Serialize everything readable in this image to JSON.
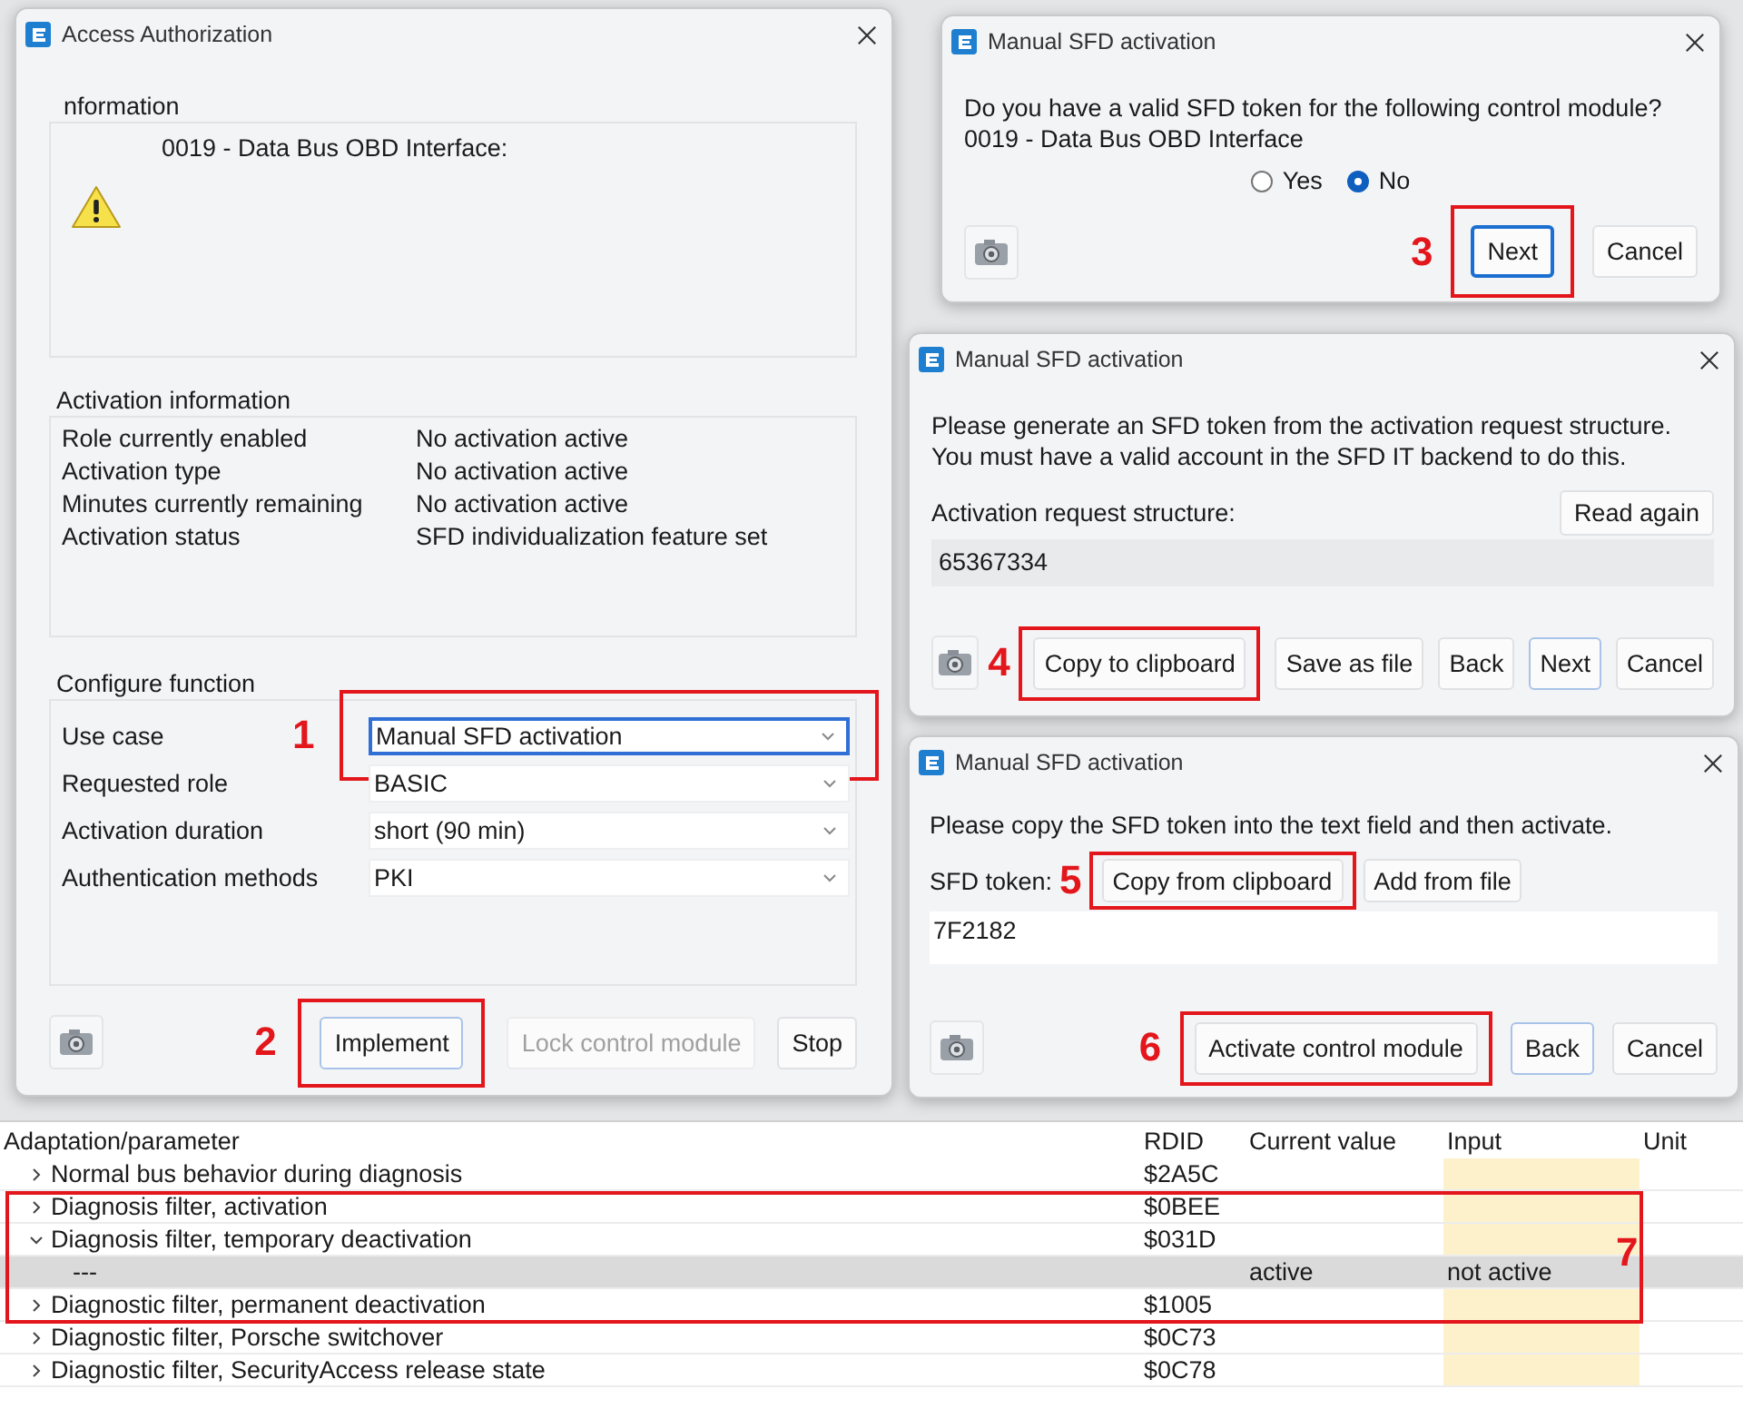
{
  "access_dialog": {
    "title": "Access Authorization",
    "info_group": {
      "legend": "nformation",
      "module": "0019 - Data Bus OBD Interface:"
    },
    "activation_info": {
      "legend": "Activation information",
      "rows": [
        {
          "label": "Role currently enabled",
          "value": "No activation active"
        },
        {
          "label": "Activation type",
          "value": "No activation active"
        },
        {
          "label": "Minutes currently remaining",
          "value": "No activation active"
        },
        {
          "label": "Activation status",
          "value": "SFD individualization feature set"
        }
      ]
    },
    "configure": {
      "legend": "Configure function",
      "rows": [
        {
          "label": "Use case",
          "value": "Manual SFD activation",
          "focused": true,
          "annotation": "1"
        },
        {
          "label": "Requested role",
          "value": "BASIC",
          "focused": false
        },
        {
          "label": "Activation duration",
          "value": "short (90 min)",
          "focused": false
        },
        {
          "label": "Authentication methods",
          "value": "PKI",
          "focused": false
        }
      ]
    },
    "buttons": [
      {
        "label": "Implement",
        "default": true,
        "disabled": false,
        "annotation": "2"
      },
      {
        "label": "Lock control module",
        "default": false,
        "disabled": true
      },
      {
        "label": "Stop",
        "default": false,
        "disabled": false
      }
    ]
  },
  "question_dialog": {
    "title": "Manual SFD activation",
    "lines": [
      "Do you have a valid SFD token for the following control module?",
      "0019 - Data Bus OBD Interface"
    ],
    "options": [
      {
        "label": "Yes",
        "selected": false
      },
      {
        "label": "No",
        "selected": true
      }
    ],
    "buttons": [
      {
        "label": "Next",
        "focused": true,
        "annotation": "3"
      },
      {
        "label": "Cancel",
        "focused": false
      }
    ]
  },
  "request_dialog": {
    "title": "Manual SFD activation",
    "lines": [
      "Please generate an SFD token from the activation request structure.",
      "You must have a valid account in the SFD IT backend to do this."
    ],
    "field_label": "Activation request structure:",
    "read_again": "Read again",
    "request_value": "65367334",
    "buttons": [
      {
        "label": "Copy to clipboard",
        "default": false,
        "annotation": "4"
      },
      {
        "label": "Save as file",
        "default": false
      },
      {
        "label": "Back",
        "default": false
      },
      {
        "label": "Next",
        "default": true
      },
      {
        "label": "Cancel",
        "default": false
      }
    ]
  },
  "token_dialog": {
    "title": "Manual SFD activation",
    "message": "Please copy the SFD token into the text field and then activate.",
    "token_label": "SFD token:",
    "token_buttons": [
      {
        "label": "Copy from clipboard",
        "annotation": "5"
      },
      {
        "label": "Add from file"
      }
    ],
    "token_value": "7F2182",
    "buttons": [
      {
        "label": "Activate control module",
        "default": false,
        "annotation": "6"
      },
      {
        "label": "Back",
        "default": true
      },
      {
        "label": "Cancel",
        "default": false
      }
    ]
  },
  "table": {
    "columns": [
      "Adaptation/parameter",
      "RDID",
      "Current value",
      "Input",
      "Unit"
    ],
    "rows": [
      {
        "parameter": "Normal bus behavior during diagnosis",
        "rdid": "$2A5C",
        "expanded": false,
        "selected": false
      },
      {
        "parameter": "Diagnosis filter, activation",
        "rdid": "$0BEE",
        "expanded": false,
        "selected": false
      },
      {
        "parameter": "Diagnosis filter, temporary deactivation",
        "rdid": "$031D",
        "expanded": true,
        "selected": false,
        "annotation": "7",
        "children": [
          {
            "parameter": "---",
            "current_value": "active",
            "input": "not active",
            "selected": true
          }
        ]
      },
      {
        "parameter": "Diagnostic filter, permanent deactivation",
        "rdid": "$1005",
        "expanded": false,
        "selected": false
      },
      {
        "parameter": "Diagnostic filter, Porsche switchover",
        "rdid": "$0C73",
        "expanded": false,
        "selected": false
      },
      {
        "parameter": "Diagnostic filter, SecurityAccess release state",
        "rdid": "$0C78",
        "expanded": false,
        "selected": false
      }
    ]
  }
}
